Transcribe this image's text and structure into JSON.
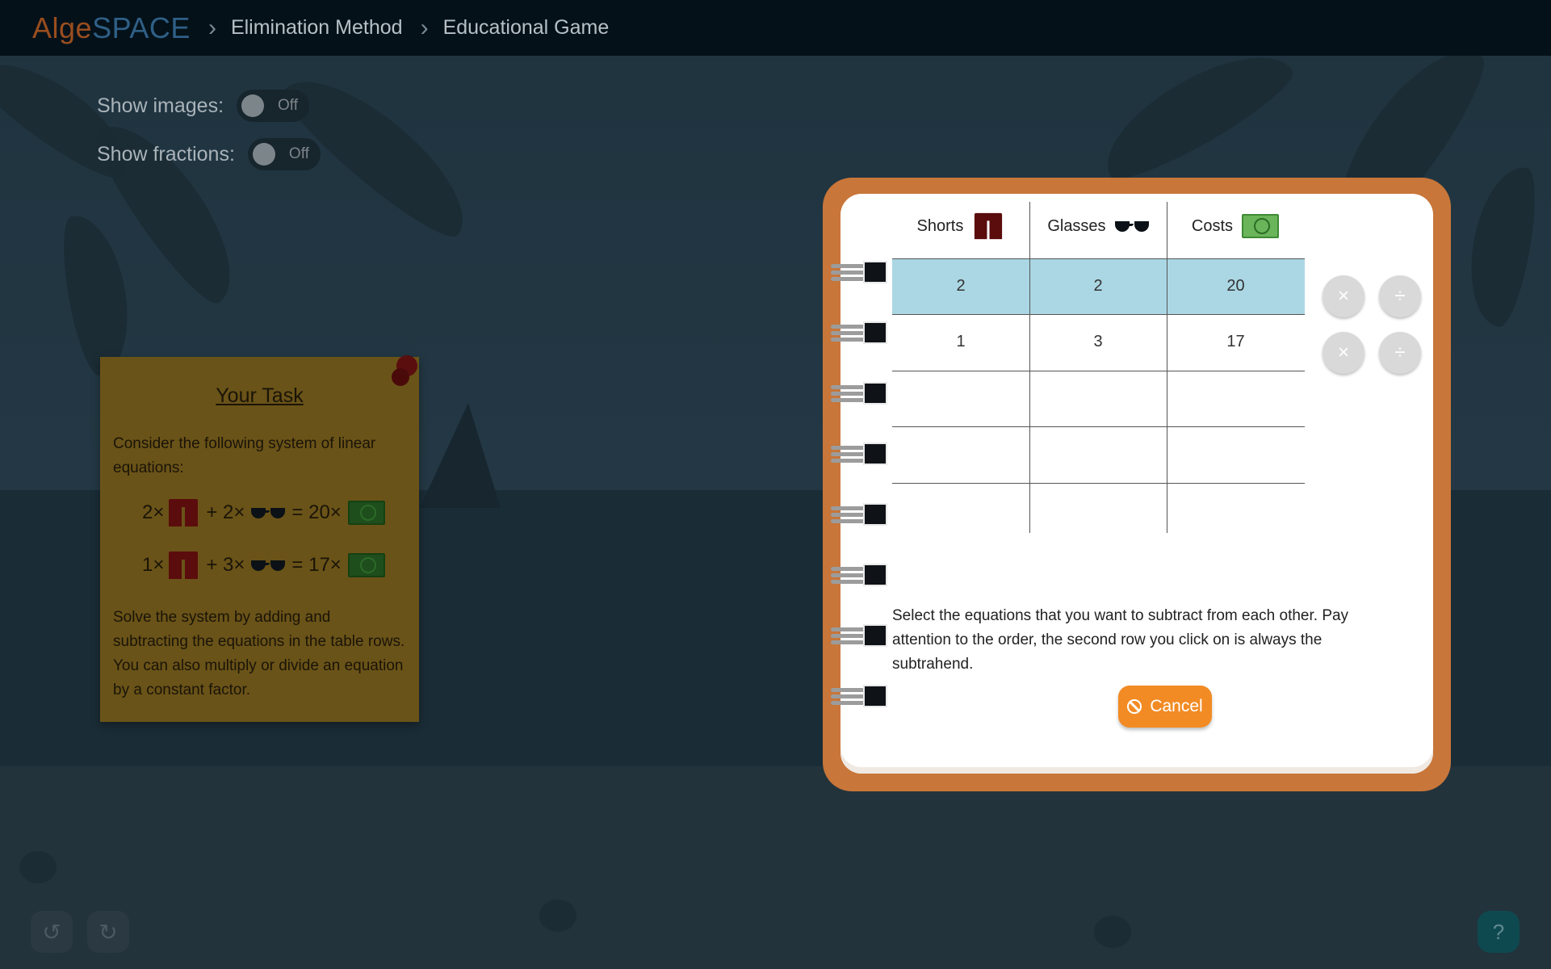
{
  "app": {
    "logo_part1": "Alge",
    "logo_part2": "SPACE"
  },
  "breadcrumb": [
    "Elimination Method",
    "Educational Game"
  ],
  "toggles": [
    {
      "label": "Show images:",
      "state": "Off"
    },
    {
      "label": "Show fractions:",
      "state": "Off"
    }
  ],
  "task": {
    "title": "Your Task",
    "intro": "Consider the following system of linear equations:",
    "equations": [
      {
        "a": "2×",
        "plus": "+ 2×",
        "eq": "= 20×"
      },
      {
        "a": "1×",
        "plus": "+ 3×",
        "eq": "= 17×"
      }
    ],
    "instructions": "Solve the system by adding and subtracting the equations in the table rows. You can also multiply or divide an equation by a constant factor."
  },
  "table": {
    "headers": [
      "Shorts",
      "Glasses",
      "Costs"
    ],
    "header_icons": [
      "shorts-icon",
      "glasses-icon",
      "money-icon"
    ],
    "rows": [
      [
        "2",
        "2",
        "20"
      ],
      [
        "1",
        "3",
        "17"
      ],
      [
        "",
        "",
        ""
      ],
      [
        "",
        "",
        ""
      ],
      [
        "",
        "",
        ""
      ]
    ],
    "highlighted_row": 0,
    "highlight_color": "#abd7e4"
  },
  "ops": {
    "multiply": "×",
    "divide": "÷"
  },
  "hint": "Select the equations that you want to subtract from each other. Pay attention to the order, the second row you click on is always the subtrahend.",
  "cancel_label": "Cancel",
  "controls": {
    "undo": "↺",
    "redo": "↻",
    "help": "?"
  },
  "colors": {
    "accent": "#f28b24",
    "notebook": "#c8763a",
    "topbar": "#041119"
  }
}
